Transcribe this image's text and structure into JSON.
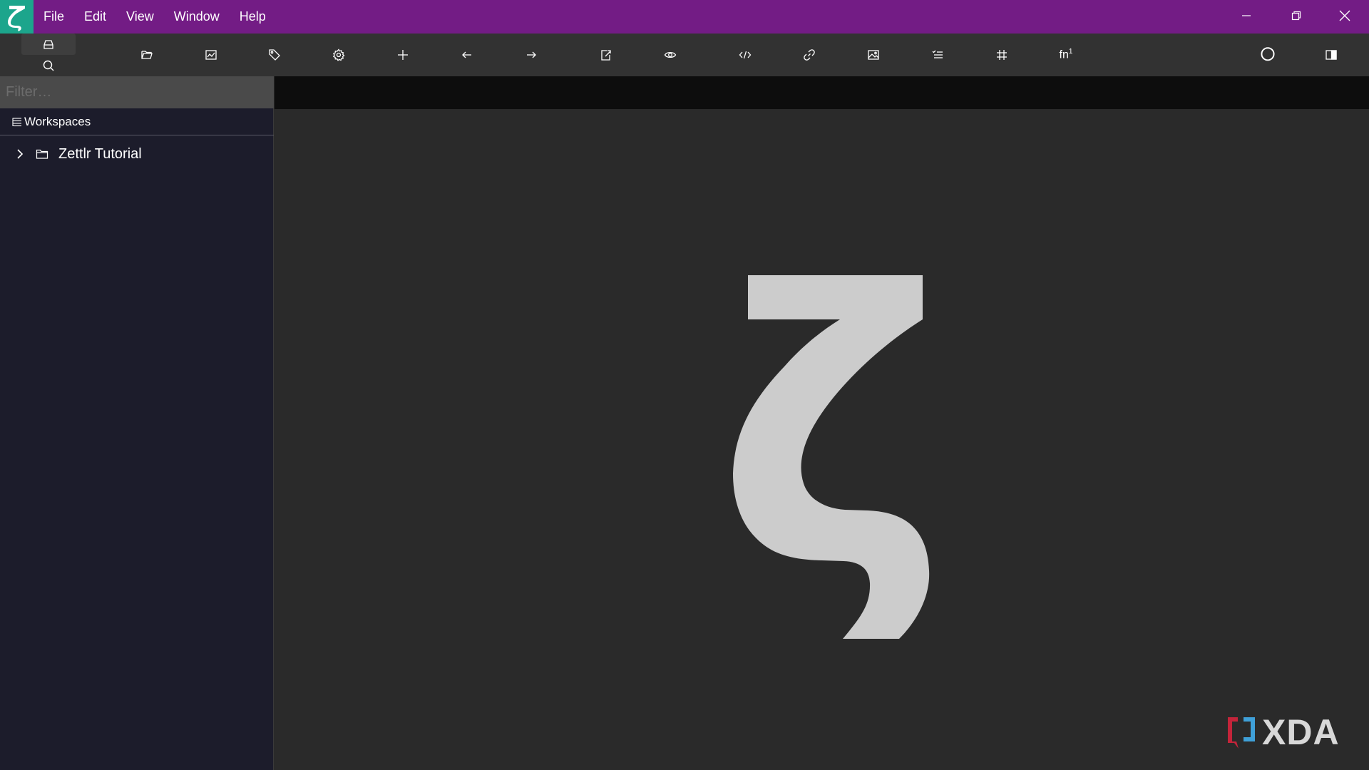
{
  "menu": {
    "items": [
      {
        "label": "File"
      },
      {
        "label": "Edit"
      },
      {
        "label": "View"
      },
      {
        "label": "Window"
      },
      {
        "label": "Help"
      }
    ]
  },
  "window_controls": {
    "minimize_icon": "minimize-icon",
    "restore_icon": "restore-icon",
    "close_icon": "close-icon"
  },
  "toolbar": {
    "sidebar_modes": [
      "file-manager-icon",
      "global-search-icon"
    ],
    "buttons": [
      "open-workspace-icon",
      "graph-view-icon",
      "tag-manager-icon",
      "preferences-icon",
      "new-file-icon",
      "navigate-back-icon",
      "navigate-forward-icon",
      "export-icon",
      "readability-mode-icon",
      "insert-code-icon",
      "insert-link-icon",
      "insert-image-icon",
      "insert-tasklist-icon",
      "insert-table-icon",
      "insert-footnote-icon",
      "pomodoro-icon",
      "toggle-sidebar-icon"
    ],
    "footnote_label": "fn",
    "footnote_sup": "1"
  },
  "sidebar": {
    "filter_placeholder": "Filter…",
    "workspaces_label": "Workspaces",
    "tree": [
      {
        "label": "Zettlr Tutorial",
        "type": "folder",
        "expanded": false
      }
    ]
  },
  "watermark": {
    "text": "XDA"
  },
  "colors": {
    "titlebar": "#731c85",
    "logo_bg": "#1ca58c",
    "toolbar": "#323232",
    "sidebar": "#1c1c2b",
    "editor": "#2a2a2a",
    "tabbar": "#0d0d0d",
    "zeta": "#cccccc"
  }
}
